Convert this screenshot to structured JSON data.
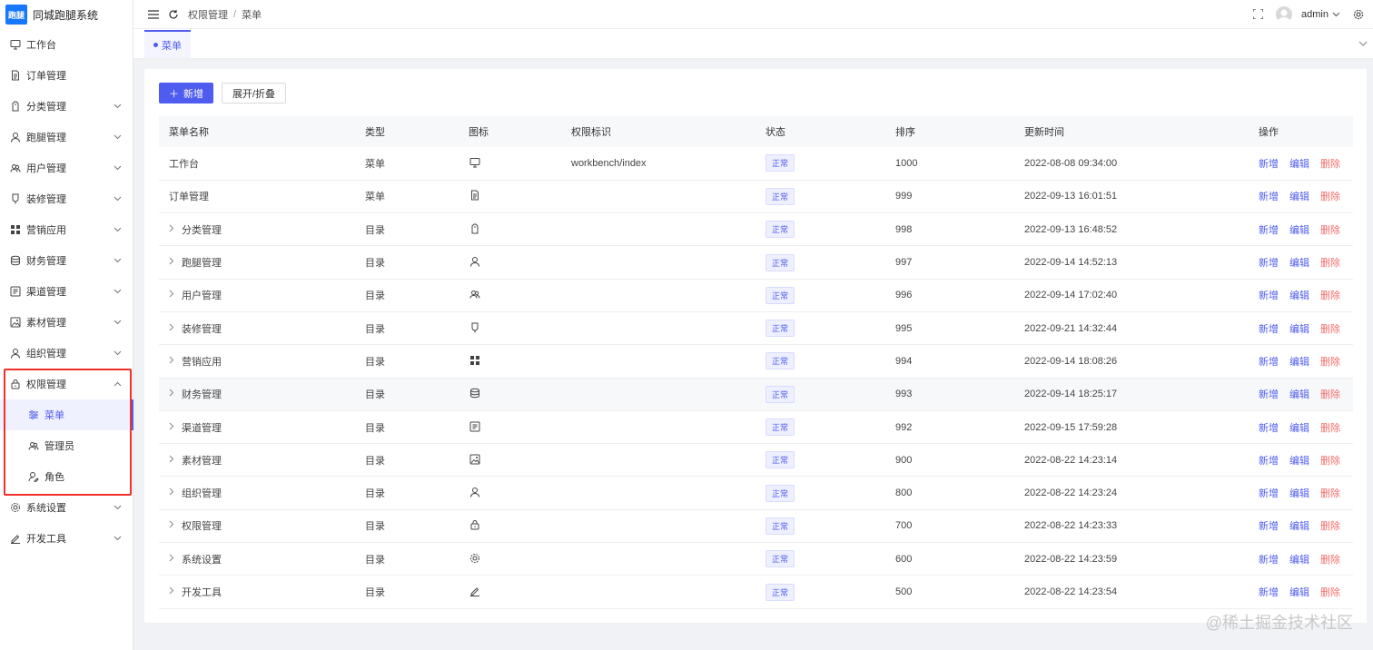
{
  "app": {
    "logo_badge": "跑腿",
    "title": "同城跑腿系统"
  },
  "sidebar": {
    "items": [
      {
        "label": "工作台",
        "icon": "monitor-icon",
        "has_children": false
      },
      {
        "label": "订单管理",
        "icon": "document-icon",
        "has_children": false
      },
      {
        "label": "分类管理",
        "icon": "tag-icon",
        "has_children": true
      },
      {
        "label": "跑腿管理",
        "icon": "user-icon",
        "has_children": true
      },
      {
        "label": "用户管理",
        "icon": "users-icon",
        "has_children": true
      },
      {
        "label": "装修管理",
        "icon": "brush-icon",
        "has_children": true
      },
      {
        "label": "营销应用",
        "icon": "grid-icon",
        "has_children": true
      },
      {
        "label": "财务管理",
        "icon": "database-icon",
        "has_children": true
      },
      {
        "label": "渠道管理",
        "icon": "channel-icon",
        "has_children": true
      },
      {
        "label": "素材管理",
        "icon": "image-icon",
        "has_children": true
      },
      {
        "label": "组织管理",
        "icon": "user-icon",
        "has_children": true
      },
      {
        "label": "权限管理",
        "icon": "lock-icon",
        "has_children": true,
        "expanded": true
      },
      {
        "label": "系统设置",
        "icon": "gear-icon",
        "has_children": true
      },
      {
        "label": "开发工具",
        "icon": "pen-icon",
        "has_children": true
      }
    ],
    "permission_children": [
      {
        "label": "菜单",
        "icon": "sliders-icon",
        "active": true
      },
      {
        "label": "管理员",
        "icon": "users-icon",
        "active": false
      },
      {
        "label": "角色",
        "icon": "role-icon",
        "active": false
      }
    ]
  },
  "header": {
    "breadcrumb": [
      "权限管理",
      "菜单"
    ],
    "breadcrumb_sep": "/",
    "user": "admin"
  },
  "tabs": [
    {
      "label": "菜单",
      "active": true
    }
  ],
  "toolbar": {
    "add_label": "新增",
    "toggle_label": "展开/折叠"
  },
  "table": {
    "columns": [
      "菜单名称",
      "类型",
      "图标",
      "权限标识",
      "状态",
      "排序",
      "更新时间",
      "操作"
    ],
    "rows": [
      {
        "name": "工作台",
        "expandable": false,
        "type": "菜单",
        "icon": "monitor-icon",
        "perm": "workbench/index",
        "status": "正常",
        "sort": "1000",
        "updated": "2022-08-08 09:34:00"
      },
      {
        "name": "订单管理",
        "expandable": false,
        "type": "菜单",
        "icon": "document-icon",
        "perm": "",
        "status": "正常",
        "sort": "999",
        "updated": "2022-09-13 16:01:51"
      },
      {
        "name": "分类管理",
        "expandable": true,
        "type": "目录",
        "icon": "tag-icon",
        "perm": "",
        "status": "正常",
        "sort": "998",
        "updated": "2022-09-13 16:48:52"
      },
      {
        "name": "跑腿管理",
        "expandable": true,
        "type": "目录",
        "icon": "user-icon",
        "perm": "",
        "status": "正常",
        "sort": "997",
        "updated": "2022-09-14 14:52:13"
      },
      {
        "name": "用户管理",
        "expandable": true,
        "type": "目录",
        "icon": "users-icon",
        "perm": "",
        "status": "正常",
        "sort": "996",
        "updated": "2022-09-14 17:02:40"
      },
      {
        "name": "装修管理",
        "expandable": true,
        "type": "目录",
        "icon": "brush-icon",
        "perm": "",
        "status": "正常",
        "sort": "995",
        "updated": "2022-09-21 14:32:44"
      },
      {
        "name": "营销应用",
        "expandable": true,
        "type": "目录",
        "icon": "grid-icon",
        "perm": "",
        "status": "正常",
        "sort": "994",
        "updated": "2022-09-14 18:08:26"
      },
      {
        "name": "财务管理",
        "expandable": true,
        "type": "目录",
        "icon": "database-icon",
        "perm": "",
        "status": "正常",
        "sort": "993",
        "updated": "2022-09-14 18:25:17"
      },
      {
        "name": "渠道管理",
        "expandable": true,
        "type": "目录",
        "icon": "channel-icon",
        "perm": "",
        "status": "正常",
        "sort": "992",
        "updated": "2022-09-15 17:59:28"
      },
      {
        "name": "素材管理",
        "expandable": true,
        "type": "目录",
        "icon": "image-icon",
        "perm": "",
        "status": "正常",
        "sort": "900",
        "updated": "2022-08-22 14:23:14"
      },
      {
        "name": "组织管理",
        "expandable": true,
        "type": "目录",
        "icon": "user-icon",
        "perm": "",
        "status": "正常",
        "sort": "800",
        "updated": "2022-08-22 14:23:24"
      },
      {
        "name": "权限管理",
        "expandable": true,
        "type": "目录",
        "icon": "lock-icon",
        "perm": "",
        "status": "正常",
        "sort": "700",
        "updated": "2022-08-22 14:23:33"
      },
      {
        "name": "系统设置",
        "expandable": true,
        "type": "目录",
        "icon": "gear-icon",
        "perm": "",
        "status": "正常",
        "sort": "600",
        "updated": "2022-08-22 14:23:59"
      },
      {
        "name": "开发工具",
        "expandable": true,
        "type": "目录",
        "icon": "pen-icon",
        "perm": "",
        "status": "正常",
        "sort": "500",
        "updated": "2022-08-22 14:23:54"
      }
    ],
    "ops": {
      "add": "新增",
      "edit": "编辑",
      "del": "删除"
    }
  },
  "watermark": "@稀土掘金技术社区",
  "colors": {
    "primary": "#4e5cf0",
    "danger": "#f56c6c",
    "highlight": "#f0302b"
  }
}
